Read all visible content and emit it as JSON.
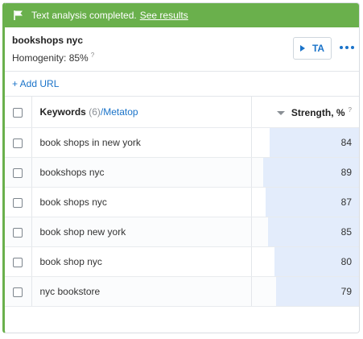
{
  "banner": {
    "message": "Text analysis completed.",
    "link": "See results",
    "icon": "flag-icon"
  },
  "header": {
    "title": "bookshops nyc",
    "homogenity_label": "Homogenity: 85%",
    "help_mark": "?",
    "ta_button": "TA"
  },
  "add_url": "+ Add URL",
  "table": {
    "keywords_header": "Keywords",
    "keywords_count": "(6)",
    "metatop_link": "/Metatop",
    "strength_header": "Strength, %",
    "strength_help": "?",
    "rows": [
      {
        "keyword": "book shops in new york",
        "strength": 84
      },
      {
        "keyword": "bookshops nyc",
        "strength": 89
      },
      {
        "keyword": "book shops nyc",
        "strength": 87
      },
      {
        "keyword": "book shop new york",
        "strength": 85
      },
      {
        "keyword": "book shop nyc",
        "strength": 80
      },
      {
        "keyword": "nyc bookstore",
        "strength": 79
      }
    ]
  },
  "colors": {
    "banner": "#6ab04c",
    "accent": "#1a73c9",
    "bar": "#e3ecfb"
  }
}
